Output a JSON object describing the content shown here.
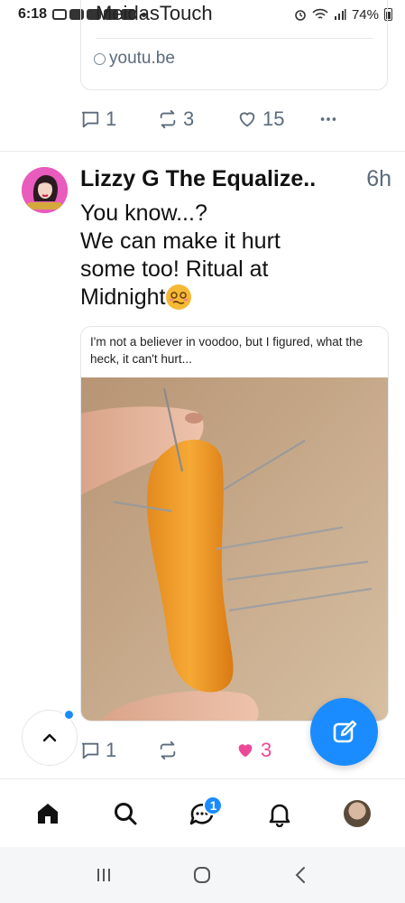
{
  "status_bar": {
    "time": "6:18",
    "battery": "74%"
  },
  "prev_post": {
    "link_title": "MeidasTouch",
    "link_domain": "youtu.be",
    "replies": "1",
    "reposts": "3",
    "likes": "15"
  },
  "post": {
    "author": "Lizzy G The Equalize..",
    "time": "6h",
    "text": "You know...?\nWe can make it hurt\nsome too! Ritual at\nMidnight",
    "embed_caption": "I'm not a believer in voodoo, but I figured, what the heck, it can't hurt...",
    "replies": "1",
    "reposts": "",
    "likes": "3"
  },
  "nav": {
    "chat_badge": "1"
  },
  "colors": {
    "accent": "#1a8cff",
    "like_active": "#ec4899",
    "muted": "#5b6b7c"
  }
}
